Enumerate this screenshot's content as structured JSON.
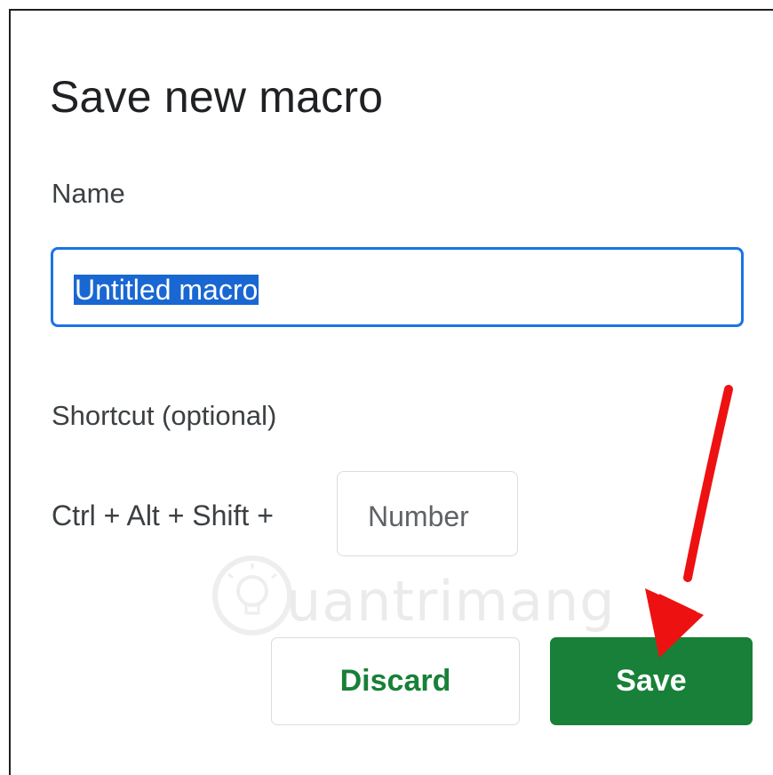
{
  "dialog": {
    "title": "Save new macro",
    "name_label": "Name",
    "name_value": "Untitled macro",
    "shortcut_label": "Shortcut (optional)",
    "shortcut_combo": "Ctrl + Alt + Shift +",
    "number_placeholder": "Number",
    "discard_label": "Discard",
    "save_label": "Save"
  },
  "watermark": {
    "text": "uantrimang",
    "icon": "lightbulb-icon"
  },
  "annotation": {
    "icon": "red-arrow-icon",
    "color": "#ee1111"
  },
  "colors": {
    "accent_blue": "#1a73e8",
    "selection": "#1967d2",
    "green": "#188038"
  }
}
